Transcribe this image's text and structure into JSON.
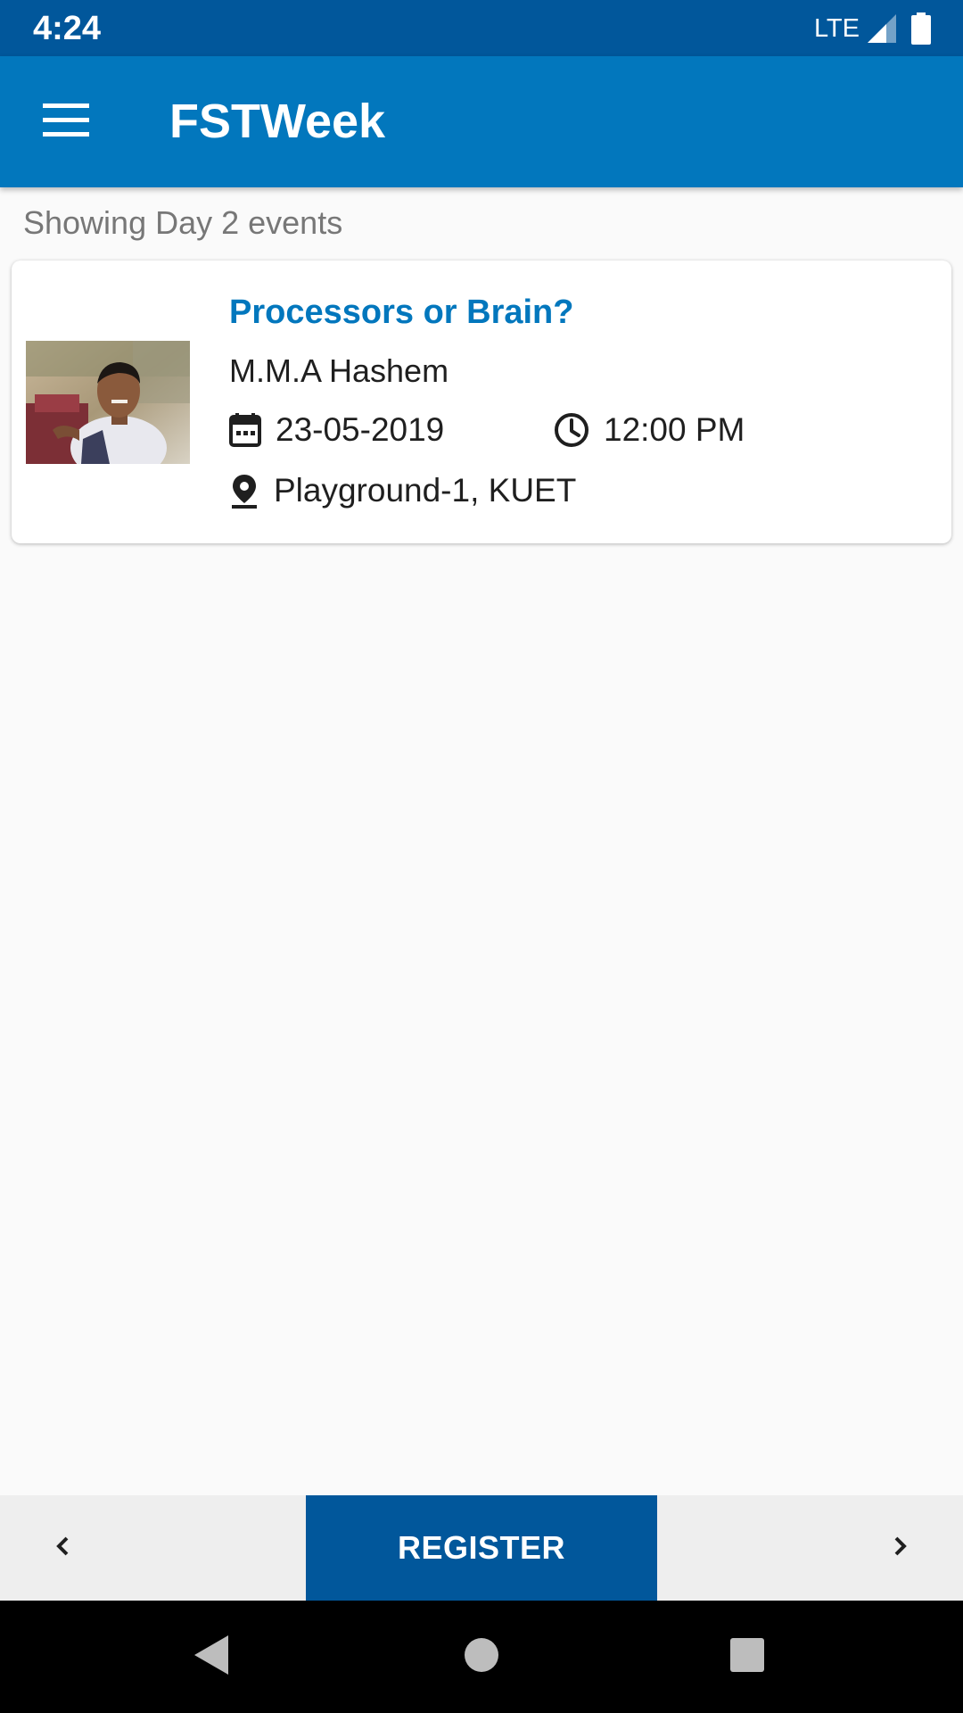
{
  "status_bar": {
    "time": "4:24",
    "network": "LTE",
    "icons": [
      "signal-icon",
      "battery-icon"
    ]
  },
  "app_bar": {
    "title": "FSTWeek",
    "menu_icon": "hamburger-menu-icon"
  },
  "filter": {
    "label": "Showing Day 2 events"
  },
  "events": [
    {
      "title": "Processors or Brain?",
      "speaker": "M.M.A Hashem",
      "date": "23-05-2019",
      "time": "12:00 PM",
      "venue": "Playground-1, KUET",
      "icons": [
        "calendar-icon",
        "clock-icon",
        "location-pin-icon"
      ]
    }
  ],
  "bottom_bar": {
    "prev_icon": "chevron-left-icon",
    "register_label": "REGISTER",
    "next_icon": "chevron-right-icon"
  },
  "nav_bar": {
    "icons": [
      "back-icon",
      "home-icon",
      "recents-icon"
    ]
  },
  "colors": {
    "status_bar": "#01579b",
    "app_bar": "#0277bd",
    "accent_title": "#0277bd",
    "register_button": "#01579b",
    "background": "#fafafa"
  }
}
